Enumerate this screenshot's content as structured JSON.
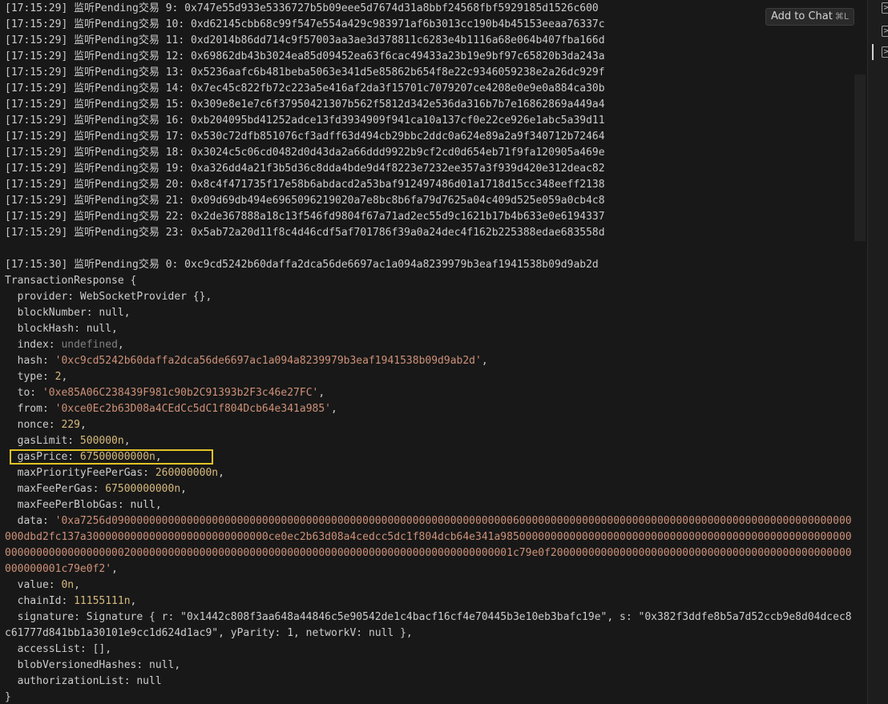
{
  "terminal": {
    "pending_lines": [
      "[17:15:29] 监听Pending交易 9: 0x747e55d933e5336727b5b09eee5d7674d31a8bbf24568fbf5929185d1526c600",
      "[17:15:29] 监听Pending交易 10: 0xd62145cbb68c99f547e554a429c983971af6b3013cc190b4b45153eeaa76337c",
      "[17:15:29] 监听Pending交易 11: 0xd2014b86dd714c9f57003aa3ae3d378811c6283e4b1116a68e064b407fba166d",
      "[17:15:29] 监听Pending交易 12: 0x69862db43b3024ea85d09452ea63f6cac49433a23b19e9bf97c65820b3da243a",
      "[17:15:29] 监听Pending交易 13: 0x5236aafc6b481beba5063e341d5e85862b654f8e22c9346059238e2a26dc929f",
      "[17:15:29] 监听Pending交易 14: 0x7ec45c822fb72c223a5e416af2da3f15701c7079207ce4208e0e9e0a884ca30b",
      "[17:15:29] 监听Pending交易 15: 0x309e8e1e7c6f37950421307b562f5812d342e536da316b7b7e16862869a449a4",
      "[17:15:29] 监听Pending交易 16: 0xb204095bd41252adce13fd3934909f941ca10a137cf0e22ce926e1abc5a39d11",
      "[17:15:29] 监听Pending交易 17: 0x530c72dfb851076cf3adff63d494cb29bbc2ddc0a624e89a2a9f340712b72464",
      "[17:15:29] 监听Pending交易 18: 0x3024c5c06cd0482d0d43da2a66ddd9922b9cf2cd0d654eb71f9fa120905a469e",
      "[17:15:29] 监听Pending交易 19: 0xa326dd4a21f3b5d36c8dda4bde9d4f8223e7232ee357a3f939d420e312deac82",
      "[17:15:29] 监听Pending交易 20: 0x8c4f471735f17e58b6abdacd2a53baf912497486d01a1718d15cc348eeff2138",
      "[17:15:29] 监听Pending交易 21: 0x09d69db494e6965096219020a7e8bc8b6fa79d7625a04c409d525e059a0cb4c8",
      "[17:15:29] 监听Pending交易 22: 0x2de367888a18c13f546fd9804f67a71ad2ec55d9c1621b17b4b633e0e6194337",
      "[17:15:29] 监听Pending交易 23: 0x5ab72a20d11f8c4d46cdf5af701786f39a0a24dec4f162b225388edae683558d"
    ],
    "new_pending_line": "[17:15:30] 监听Pending交易 0: 0xc9cd5242b60daffa2dca56de6697ac1a094a8239979b3eaf1941538b09d9ab2d",
    "tx": {
      "open": "TransactionResponse {",
      "provider_key": "  provider: ",
      "provider_val": "WebSocketProvider {},",
      "blockNumber": "  blockNumber: null,",
      "blockHash": "  blockHash: null,",
      "index_key": "  index: ",
      "index_val": "undefined",
      "hash_key": "  hash: ",
      "hash_val": "'0xc9cd5242b60daffa2dca56de6697ac1a094a8239979b3eaf1941538b09d9ab2d'",
      "type_key": "  type: ",
      "type_val": "2",
      "to_key": "  to: ",
      "to_val": "'0xe85A06C238439F981c90b2C91393b2F3c46e27FC'",
      "from_key": "  from: ",
      "from_val": "'0xce0Ec2b63D08a4CEdCc5dC1f804Dcb64e341a985'",
      "nonce_key": "  nonce: ",
      "nonce_val": "229",
      "gasLimit_key": "  gasLimit: ",
      "gasLimit_val": "500000n",
      "gasPrice_key": "  gasPrice: ",
      "gasPrice_val": "67500000000n",
      "maxPriorityFeePerGas_key": "  maxPriorityFeePerGas: ",
      "maxPriorityFeePerGas_val": "260000000n",
      "maxFeePerGas_key": "  maxFeePerGas: ",
      "maxFeePerGas_val": "67500000000n",
      "maxFeePerBlobGas": "  maxFeePerBlobGas: null,",
      "data_key": "  data: ",
      "data_val": "'0xa7256d0900000000000000000000000000000000000000000000000000000000000000600000000000000000000000000000000000000000000000000000000dbd2fc137a30000000000000000000000000000ce0ec2b63d08a4cedcc5dc1f804dcb64e341a98500000000000000000000000000000000000000000000000000000000000000000000000020000000000000000000000000000000000000000000000000000000000001c79e0f200000000000000000000000000000000000000000000000000000001c79e0f2'",
      "value_key": "  value: ",
      "value_val": "0n",
      "chainId_key": "  chainId: ",
      "chainId_val": "11155111n",
      "signature": "  signature: Signature { r: \"0x1442c808f3aa648a44846c5e90542de1c4bacf16cf4e70445b3e10eb3bafc19e\", s: \"0x382f3ddfe8b5a7d52ccb9e8d04dcec8c61777d841bb1a30101e9cc1d624d1ac9\", yParity: 1, networkV: null },",
      "accessList": "  accessList: [],",
      "blobVersionedHashes": "  blobVersionedHashes: null,",
      "authorizationList": "  authorizationList: null",
      "close": "}"
    }
  },
  "add_to_chat": {
    "label": "Add to Chat",
    "shortcut": "⌘L"
  },
  "colors": {
    "background": "#181818",
    "text": "#cccccc",
    "string": "#ce9178",
    "number": "#d7ba7d",
    "highlight_box": "#e2c325"
  },
  "panel_icons": [
    "terminal-icon",
    "terminal-icon",
    "terminal-icon"
  ]
}
